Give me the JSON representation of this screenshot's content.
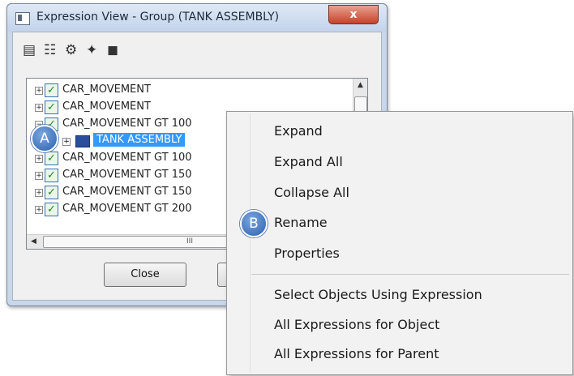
{
  "window": {
    "title": "Expression View - Group (TANK ASSEMBLY)",
    "close_glyph": "x",
    "toolbar_icons": [
      "properties-icon",
      "hierarchy-icon",
      "filter-icon",
      "branch-icon",
      "copy-icon"
    ]
  },
  "tree": {
    "rows": [
      {
        "label": "CAR_MOVEMENT",
        "checked": true
      },
      {
        "label": "CAR_MOVEMENT",
        "checked": true
      },
      {
        "label": "CAR_MOVEMENT GT 100",
        "checked": true
      },
      {
        "label": "TANK ASSEMBLY",
        "selected": true
      },
      {
        "label": "CAR_MOVEMENT GT 100",
        "checked": true
      },
      {
        "label": "CAR_MOVEMENT GT 150",
        "checked": true
      },
      {
        "label": "CAR_MOVEMENT GT 150",
        "checked": true
      },
      {
        "label": "CAR_MOVEMENT GT 200",
        "checked": true
      }
    ],
    "hscroll_grip": "III"
  },
  "buttons": {
    "close_label": "Close"
  },
  "context_menu": {
    "items": [
      "Expand",
      "Expand All",
      "Collapse All",
      "Rename",
      "Properties"
    ],
    "items_after_separator": [
      "Select Objects Using Expression",
      "All Expressions for Object",
      "All Expressions for Parent"
    ]
  },
  "callouts": {
    "a": "A",
    "b": "B"
  },
  "colors": {
    "selection": "#3399ff",
    "callout": "#2c5fae"
  }
}
